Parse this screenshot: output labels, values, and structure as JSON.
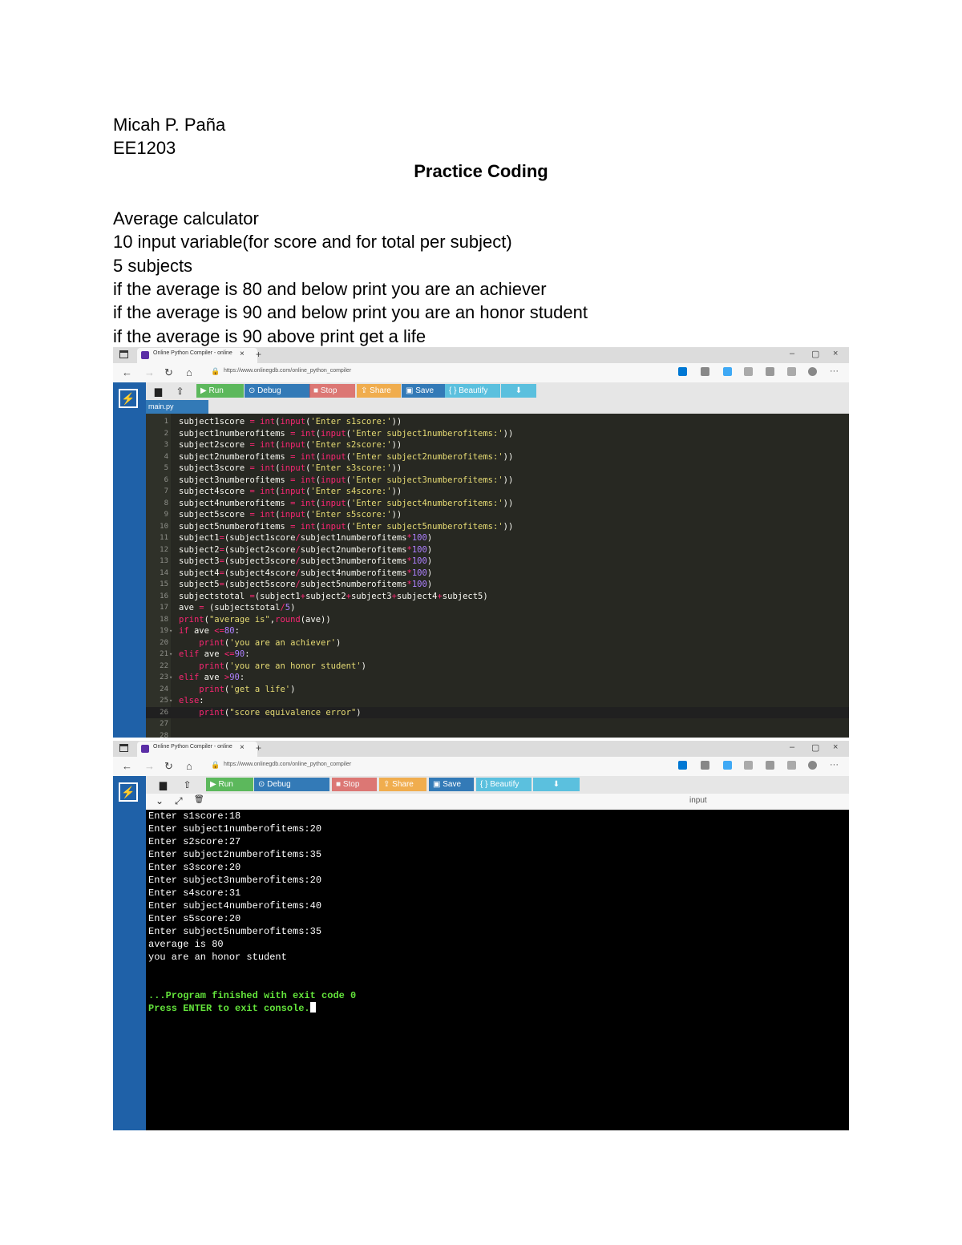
{
  "document": {
    "name": "Micah P. Paña",
    "course": "EE1203",
    "title": "Practice Coding",
    "lines": [
      "Average calculator",
      "10 input variable(for score and for total per subject)",
      "5 subjects",
      "if the average is 80 and below print you are an achiever",
      "if the average is 90 and below print you are an honor student",
      "if the average is 90 above print get a life"
    ]
  },
  "browser": {
    "tab_title": "Online Python Compiler - online",
    "tab_close": "×",
    "new_tab": "+",
    "url": "https://www.onlinegdb.com/online_python_compiler",
    "minimize": "–",
    "restore": "▢",
    "close": "×",
    "nav": {
      "back": "←",
      "forward": "→",
      "refresh": "↻",
      "home": "⌂"
    },
    "menu": "···"
  },
  "toolbar": {
    "new_file": "▆",
    "upload": "⇧",
    "run": "▶ Run",
    "debug": "⊙ Debug",
    "stop": "■ Stop",
    "share": "⇪ Share",
    "save": "▣ Save",
    "beautify": "{ } Beautify",
    "download": "⬇"
  },
  "editor": {
    "file_tab": "main.py",
    "lines": [
      {
        "n": "1",
        "fold": "",
        "parts": [
          [
            "v",
            "subject1score "
          ],
          [
            "o",
            "= "
          ],
          [
            "k",
            "int"
          ],
          [
            "v",
            "("
          ],
          [
            "k",
            "input"
          ],
          [
            "v",
            "("
          ],
          [
            "s",
            "'Enter s1score:'"
          ],
          [
            "v",
            "))"
          ]
        ]
      },
      {
        "n": "2",
        "fold": "",
        "parts": [
          [
            "v",
            "subject1numberofitems "
          ],
          [
            "o",
            "= "
          ],
          [
            "k",
            "int"
          ],
          [
            "v",
            "("
          ],
          [
            "k",
            "input"
          ],
          [
            "v",
            "("
          ],
          [
            "s",
            "'Enter subject1numberofitems:'"
          ],
          [
            "v",
            "))"
          ]
        ]
      },
      {
        "n": "3",
        "fold": "",
        "parts": [
          [
            "v",
            "subject2score "
          ],
          [
            "o",
            "= "
          ],
          [
            "k",
            "int"
          ],
          [
            "v",
            "("
          ],
          [
            "k",
            "input"
          ],
          [
            "v",
            "("
          ],
          [
            "s",
            "'Enter s2score:'"
          ],
          [
            "v",
            "))"
          ]
        ]
      },
      {
        "n": "4",
        "fold": "",
        "parts": [
          [
            "v",
            "subject2numberofitems "
          ],
          [
            "o",
            "= "
          ],
          [
            "k",
            "int"
          ],
          [
            "v",
            "("
          ],
          [
            "k",
            "input"
          ],
          [
            "v",
            "("
          ],
          [
            "s",
            "'Enter subject2numberofitems:'"
          ],
          [
            "v",
            "))"
          ]
        ]
      },
      {
        "n": "5",
        "fold": "",
        "parts": [
          [
            "v",
            "subject3score "
          ],
          [
            "o",
            "= "
          ],
          [
            "k",
            "int"
          ],
          [
            "v",
            "("
          ],
          [
            "k",
            "input"
          ],
          [
            "v",
            "("
          ],
          [
            "s",
            "'Enter s3score:'"
          ],
          [
            "v",
            "))"
          ]
        ]
      },
      {
        "n": "6",
        "fold": "",
        "parts": [
          [
            "v",
            "subject3numberofitems "
          ],
          [
            "o",
            "= "
          ],
          [
            "k",
            "int"
          ],
          [
            "v",
            "("
          ],
          [
            "k",
            "input"
          ],
          [
            "v",
            "("
          ],
          [
            "s",
            "'Enter subject3numberofitems:'"
          ],
          [
            "v",
            "))"
          ]
        ]
      },
      {
        "n": "7",
        "fold": "",
        "parts": [
          [
            "v",
            "subject4score "
          ],
          [
            "o",
            "= "
          ],
          [
            "k",
            "int"
          ],
          [
            "v",
            "("
          ],
          [
            "k",
            "input"
          ],
          [
            "v",
            "("
          ],
          [
            "s",
            "'Enter s4score:'"
          ],
          [
            "v",
            "))"
          ]
        ]
      },
      {
        "n": "8",
        "fold": "",
        "parts": [
          [
            "v",
            "subject4numberofitems "
          ],
          [
            "o",
            "= "
          ],
          [
            "k",
            "int"
          ],
          [
            "v",
            "("
          ],
          [
            "k",
            "input"
          ],
          [
            "v",
            "("
          ],
          [
            "s",
            "'Enter subject4numberofitems:'"
          ],
          [
            "v",
            "))"
          ]
        ]
      },
      {
        "n": "9",
        "fold": "",
        "parts": [
          [
            "v",
            "subject5score "
          ],
          [
            "o",
            "= "
          ],
          [
            "k",
            "int"
          ],
          [
            "v",
            "("
          ],
          [
            "k",
            "input"
          ],
          [
            "v",
            "("
          ],
          [
            "s",
            "'Enter s5score:'"
          ],
          [
            "v",
            "))"
          ]
        ]
      },
      {
        "n": "10",
        "fold": "",
        "parts": [
          [
            "v",
            "subject5numberofitems "
          ],
          [
            "o",
            "= "
          ],
          [
            "k",
            "int"
          ],
          [
            "v",
            "("
          ],
          [
            "k",
            "input"
          ],
          [
            "v",
            "("
          ],
          [
            "s",
            "'Enter subject5numberofitems:'"
          ],
          [
            "v",
            "))"
          ]
        ]
      },
      {
        "n": "11",
        "fold": "",
        "parts": [
          [
            "v",
            "subject1"
          ],
          [
            "o",
            "="
          ],
          [
            "v",
            "(subject1score"
          ],
          [
            "o",
            "/"
          ],
          [
            "v",
            "subject1numberofitems"
          ],
          [
            "o",
            "*"
          ],
          [
            "n",
            "100"
          ],
          [
            "v",
            ")"
          ]
        ]
      },
      {
        "n": "12",
        "fold": "",
        "parts": [
          [
            "v",
            "subject2"
          ],
          [
            "o",
            "="
          ],
          [
            "v",
            "(subject2score"
          ],
          [
            "o",
            "/"
          ],
          [
            "v",
            "subject2numberofitems"
          ],
          [
            "o",
            "*"
          ],
          [
            "n",
            "100"
          ],
          [
            "v",
            ")"
          ]
        ]
      },
      {
        "n": "13",
        "fold": "",
        "parts": [
          [
            "v",
            "subject3"
          ],
          [
            "o",
            "="
          ],
          [
            "v",
            "(subject3score"
          ],
          [
            "o",
            "/"
          ],
          [
            "v",
            "subject3numberofitems"
          ],
          [
            "o",
            "*"
          ],
          [
            "n",
            "100"
          ],
          [
            "v",
            ")"
          ]
        ]
      },
      {
        "n": "14",
        "fold": "",
        "parts": [
          [
            "v",
            "subject4"
          ],
          [
            "o",
            "="
          ],
          [
            "v",
            "(subject4score"
          ],
          [
            "o",
            "/"
          ],
          [
            "v",
            "subject4numberofitems"
          ],
          [
            "o",
            "*"
          ],
          [
            "n",
            "100"
          ],
          [
            "v",
            ")"
          ]
        ]
      },
      {
        "n": "15",
        "fold": "",
        "parts": [
          [
            "v",
            "subject5"
          ],
          [
            "o",
            "="
          ],
          [
            "v",
            "(subject5score"
          ],
          [
            "o",
            "/"
          ],
          [
            "v",
            "subject5numberofitems"
          ],
          [
            "o",
            "*"
          ],
          [
            "n",
            "100"
          ],
          [
            "v",
            ")"
          ]
        ]
      },
      {
        "n": "16",
        "fold": "",
        "parts": [
          [
            "v",
            "subjectstotal "
          ],
          [
            "o",
            "="
          ],
          [
            "v",
            "(subject1"
          ],
          [
            "o",
            "+"
          ],
          [
            "v",
            "subject2"
          ],
          [
            "o",
            "+"
          ],
          [
            "v",
            "subject3"
          ],
          [
            "o",
            "+"
          ],
          [
            "v",
            "subject4"
          ],
          [
            "o",
            "+"
          ],
          [
            "v",
            "subject5)"
          ]
        ]
      },
      {
        "n": "17",
        "fold": "",
        "parts": [
          [
            "v",
            "ave "
          ],
          [
            "o",
            "= "
          ],
          [
            "v",
            "(subjectstotal"
          ],
          [
            "o",
            "/"
          ],
          [
            "n",
            "5"
          ],
          [
            "v",
            ")"
          ]
        ]
      },
      {
        "n": "18",
        "fold": "",
        "parts": [
          [
            "k",
            "print"
          ],
          [
            "v",
            "("
          ],
          [
            "s",
            "\"average is\""
          ],
          [
            "v",
            ","
          ],
          [
            "k",
            "round"
          ],
          [
            "v",
            "(ave))"
          ]
        ]
      },
      {
        "n": "19",
        "fold": "▾",
        "parts": [
          [
            "k",
            "if "
          ],
          [
            "v",
            "ave "
          ],
          [
            "o",
            "<="
          ],
          [
            "n",
            "80"
          ],
          [
            "v",
            ":"
          ]
        ]
      },
      {
        "n": "20",
        "fold": "",
        "parts": [
          [
            "v",
            "    "
          ],
          [
            "k",
            "print"
          ],
          [
            "v",
            "("
          ],
          [
            "s",
            "'you are an achiever'"
          ],
          [
            "v",
            ")"
          ]
        ]
      },
      {
        "n": "21",
        "fold": "▾",
        "parts": [
          [
            "k",
            "elif "
          ],
          [
            "v",
            "ave "
          ],
          [
            "o",
            "<="
          ],
          [
            "n",
            "90"
          ],
          [
            "v",
            ":"
          ]
        ]
      },
      {
        "n": "22",
        "fold": "",
        "parts": [
          [
            "v",
            "    "
          ],
          [
            "k",
            "print"
          ],
          [
            "v",
            "("
          ],
          [
            "s",
            "'you are an honor student'"
          ],
          [
            "v",
            ")"
          ]
        ]
      },
      {
        "n": "23",
        "fold": "▾",
        "parts": [
          [
            "k",
            "elif "
          ],
          [
            "v",
            "ave "
          ],
          [
            "o",
            ">"
          ],
          [
            "n",
            "90"
          ],
          [
            "v",
            ":"
          ]
        ]
      },
      {
        "n": "24",
        "fold": "",
        "parts": [
          [
            "v",
            "    "
          ],
          [
            "k",
            "print"
          ],
          [
            "v",
            "("
          ],
          [
            "s",
            "'get a life'"
          ],
          [
            "v",
            ")"
          ]
        ]
      },
      {
        "n": "25",
        "fold": "▾",
        "parts": [
          [
            "k",
            "else"
          ],
          [
            "v",
            ":"
          ]
        ]
      },
      {
        "n": "26",
        "fold": "",
        "parts": [
          [
            "v",
            "    "
          ],
          [
            "k",
            "print"
          ],
          [
            "v",
            "("
          ],
          [
            "s",
            "\"score equivalence error\""
          ],
          [
            "v",
            ")"
          ]
        ]
      },
      {
        "n": "27",
        "fold": "",
        "parts": []
      },
      {
        "n": "28",
        "fold": "",
        "parts": []
      }
    ]
  },
  "output": {
    "header_icons": {
      "collapse": "⌄",
      "expand": "⤢",
      "clear": "🗑"
    },
    "input_label": "input",
    "console_lines": [
      "Enter s1score:18",
      "Enter subject1numberofitems:20",
      "Enter s2score:27",
      "Enter subject2numberofitems:35",
      "Enter s3score:20",
      "Enter subject3numberofitems:20",
      "Enter s4score:31",
      "Enter subject4numberofitems:40",
      "Enter s5score:20",
      "Enter subject5numberofitems:35",
      "average is 80",
      "you are an honor student"
    ],
    "finish_line": "...Program finished with exit code 0",
    "exit_line": "Press ENTER to exit console."
  },
  "colors": {
    "sidebar": "#1f61a8",
    "editor_bg": "#272822",
    "keyword": "#f92672",
    "string": "#e6db74",
    "number": "#ae81ff",
    "console_green": "#63e33b"
  }
}
